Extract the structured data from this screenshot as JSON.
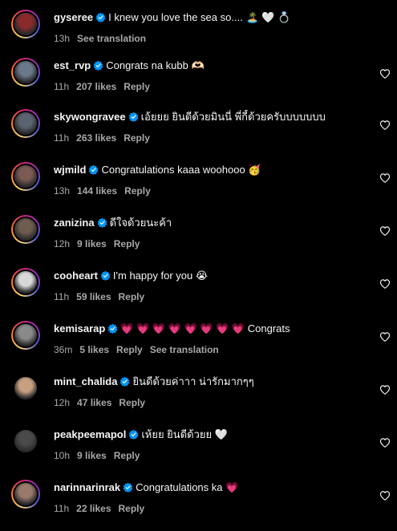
{
  "comments": [
    {
      "username": "gyseree",
      "text": "I knew you love the sea so....",
      "emoji": "🏝️ 🤍 💍",
      "time": "13h",
      "likes": "",
      "actions": [
        "See translation"
      ],
      "avatar_color": "#8a2b2b",
      "ring": true,
      "heart": false
    },
    {
      "username": "est_rvp",
      "text": "Congrats na kubb",
      "emoji": "🫶🏻",
      "time": "11h",
      "likes": "207 likes",
      "actions": [
        "Reply"
      ],
      "avatar_color": "#6b7a8a",
      "ring": true,
      "heart": true
    },
    {
      "username": "skywongravee",
      "text": "เอ้ยยย ยินดีด้วยมินนี่ พี่กี้ด้วยครับบบบบบบ",
      "emoji": "",
      "time": "11h",
      "likes": "263 likes",
      "actions": [
        "Reply"
      ],
      "avatar_color": "#5a6470",
      "ring": true,
      "heart": true
    },
    {
      "username": "wjmild",
      "text": "Congratulations kaaa woohooo",
      "emoji": "🥳",
      "time": "13h",
      "likes": "144 likes",
      "actions": [
        "Reply"
      ],
      "avatar_color": "#7a5a52",
      "ring": true,
      "heart": true
    },
    {
      "username": "zanizina",
      "text": "ดีใจด้วยนะค้า",
      "emoji": "",
      "time": "12h",
      "likes": "9 likes",
      "actions": [
        "Reply"
      ],
      "avatar_color": "#6e5c50",
      "ring": true,
      "heart": true
    },
    {
      "username": "cooheart",
      "text": "I'm happy for you",
      "emoji": "😭",
      "time": "11h",
      "likes": "59 likes",
      "actions": [
        "Reply"
      ],
      "avatar_color": "#d8d8d8",
      "ring": true,
      "heart": true
    },
    {
      "username": "kemisarap",
      "text": "Congrats",
      "emoji": "💗 💗 💗 💗 💗 💗 💗 💗",
      "time": "36m",
      "likes": "5 likes",
      "actions": [
        "Reply",
        "See translation"
      ],
      "avatar_color": "#8a8a8a",
      "ring": true,
      "heart": true
    },
    {
      "username": "mint_chalida",
      "text": "ยินดีด้วยค่าาา น่ารักมากๆๆ",
      "emoji": "",
      "time": "12h",
      "likes": "47 likes",
      "actions": [
        "Reply"
      ],
      "avatar_color": "#c8a080",
      "ring": false,
      "heart": true
    },
    {
      "username": "peakpeemapol",
      "text": "เห้ยย ยินดีด้วยย",
      "emoji": "🤍",
      "time": "10h",
      "likes": "9 likes",
      "actions": [
        "Reply"
      ],
      "avatar_color": "#4a4a4a",
      "ring": false,
      "heart": true
    },
    {
      "username": "narinnarinrak",
      "text": "Congratulations ka",
      "emoji": "💗",
      "time": "11h",
      "likes": "22 likes",
      "actions": [
        "Reply"
      ],
      "avatar_color": "#9a7a6a",
      "ring": true,
      "heart": true
    }
  ],
  "colors": {
    "verified": "#0095f6",
    "secondary": "#a8a8a8",
    "background": "#000000"
  }
}
